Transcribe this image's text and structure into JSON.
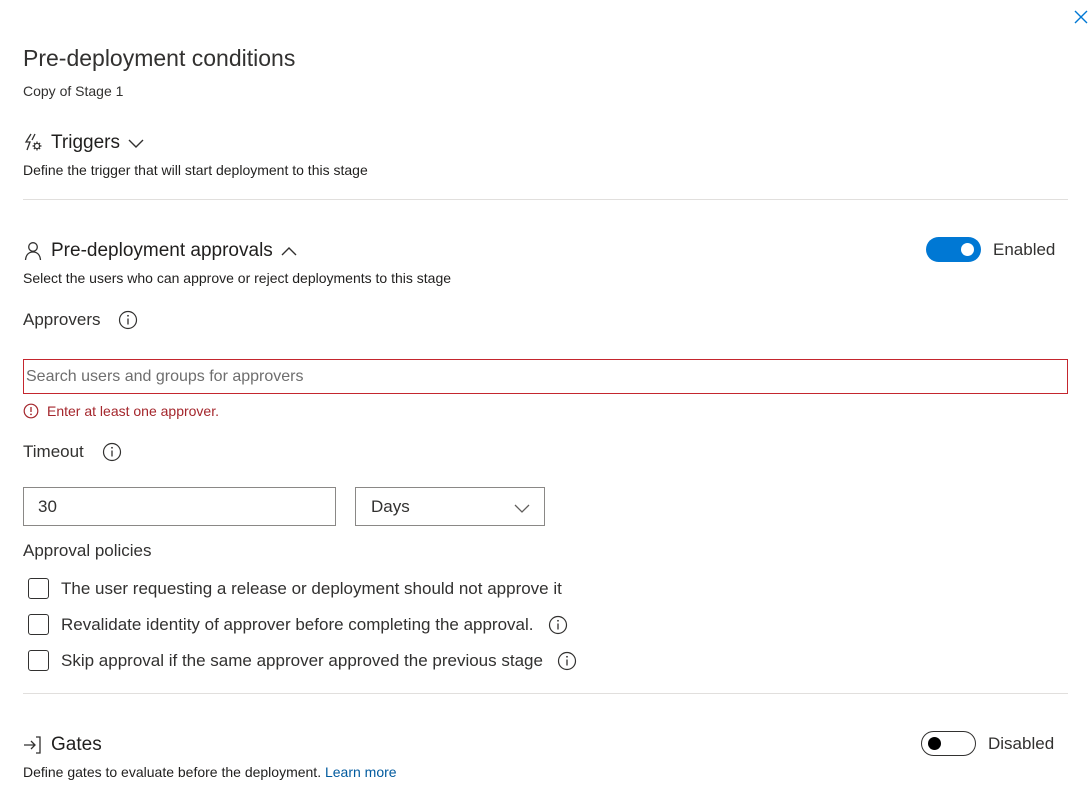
{
  "panel": {
    "title": "Pre-deployment conditions",
    "subtitle": "Copy of Stage 1",
    "close_icon": "close-icon"
  },
  "triggers": {
    "heading": "Triggers",
    "icon": "triggers-icon",
    "expanded": false,
    "description": "Define the trigger that will start deployment to this stage"
  },
  "approvals": {
    "heading": "Pre-deployment approvals",
    "icon": "person-icon",
    "expanded": true,
    "description": "Select the users who can approve or reject deployments to this stage",
    "toggle_label": "Enabled",
    "toggle_on": true,
    "approvers_label": "Approvers",
    "search_value": "",
    "search_placeholder": "Search users and groups for approvers",
    "error_text": "Enter at least one approver.",
    "timeout_label": "Timeout",
    "timeout_value": "30",
    "timeout_unit": "Days",
    "policies_title": "Approval policies",
    "policies": [
      {
        "label": "The user requesting a release or deployment should not approve it",
        "checked": false,
        "has_info": false
      },
      {
        "label": "Revalidate identity of approver before completing the approval.",
        "checked": false,
        "has_info": true
      },
      {
        "label": "Skip approval if the same approver approved the previous stage",
        "checked": false,
        "has_info": true
      }
    ]
  },
  "gates": {
    "heading": "Gates",
    "icon": "gates-icon",
    "description": "Define gates to evaluate before the deployment.",
    "learn_more": "Learn more",
    "toggle_label": "Disabled",
    "toggle_on": false
  },
  "colors": {
    "accent": "#0078d4",
    "error": "#a4262c",
    "link": "#005a9e"
  }
}
